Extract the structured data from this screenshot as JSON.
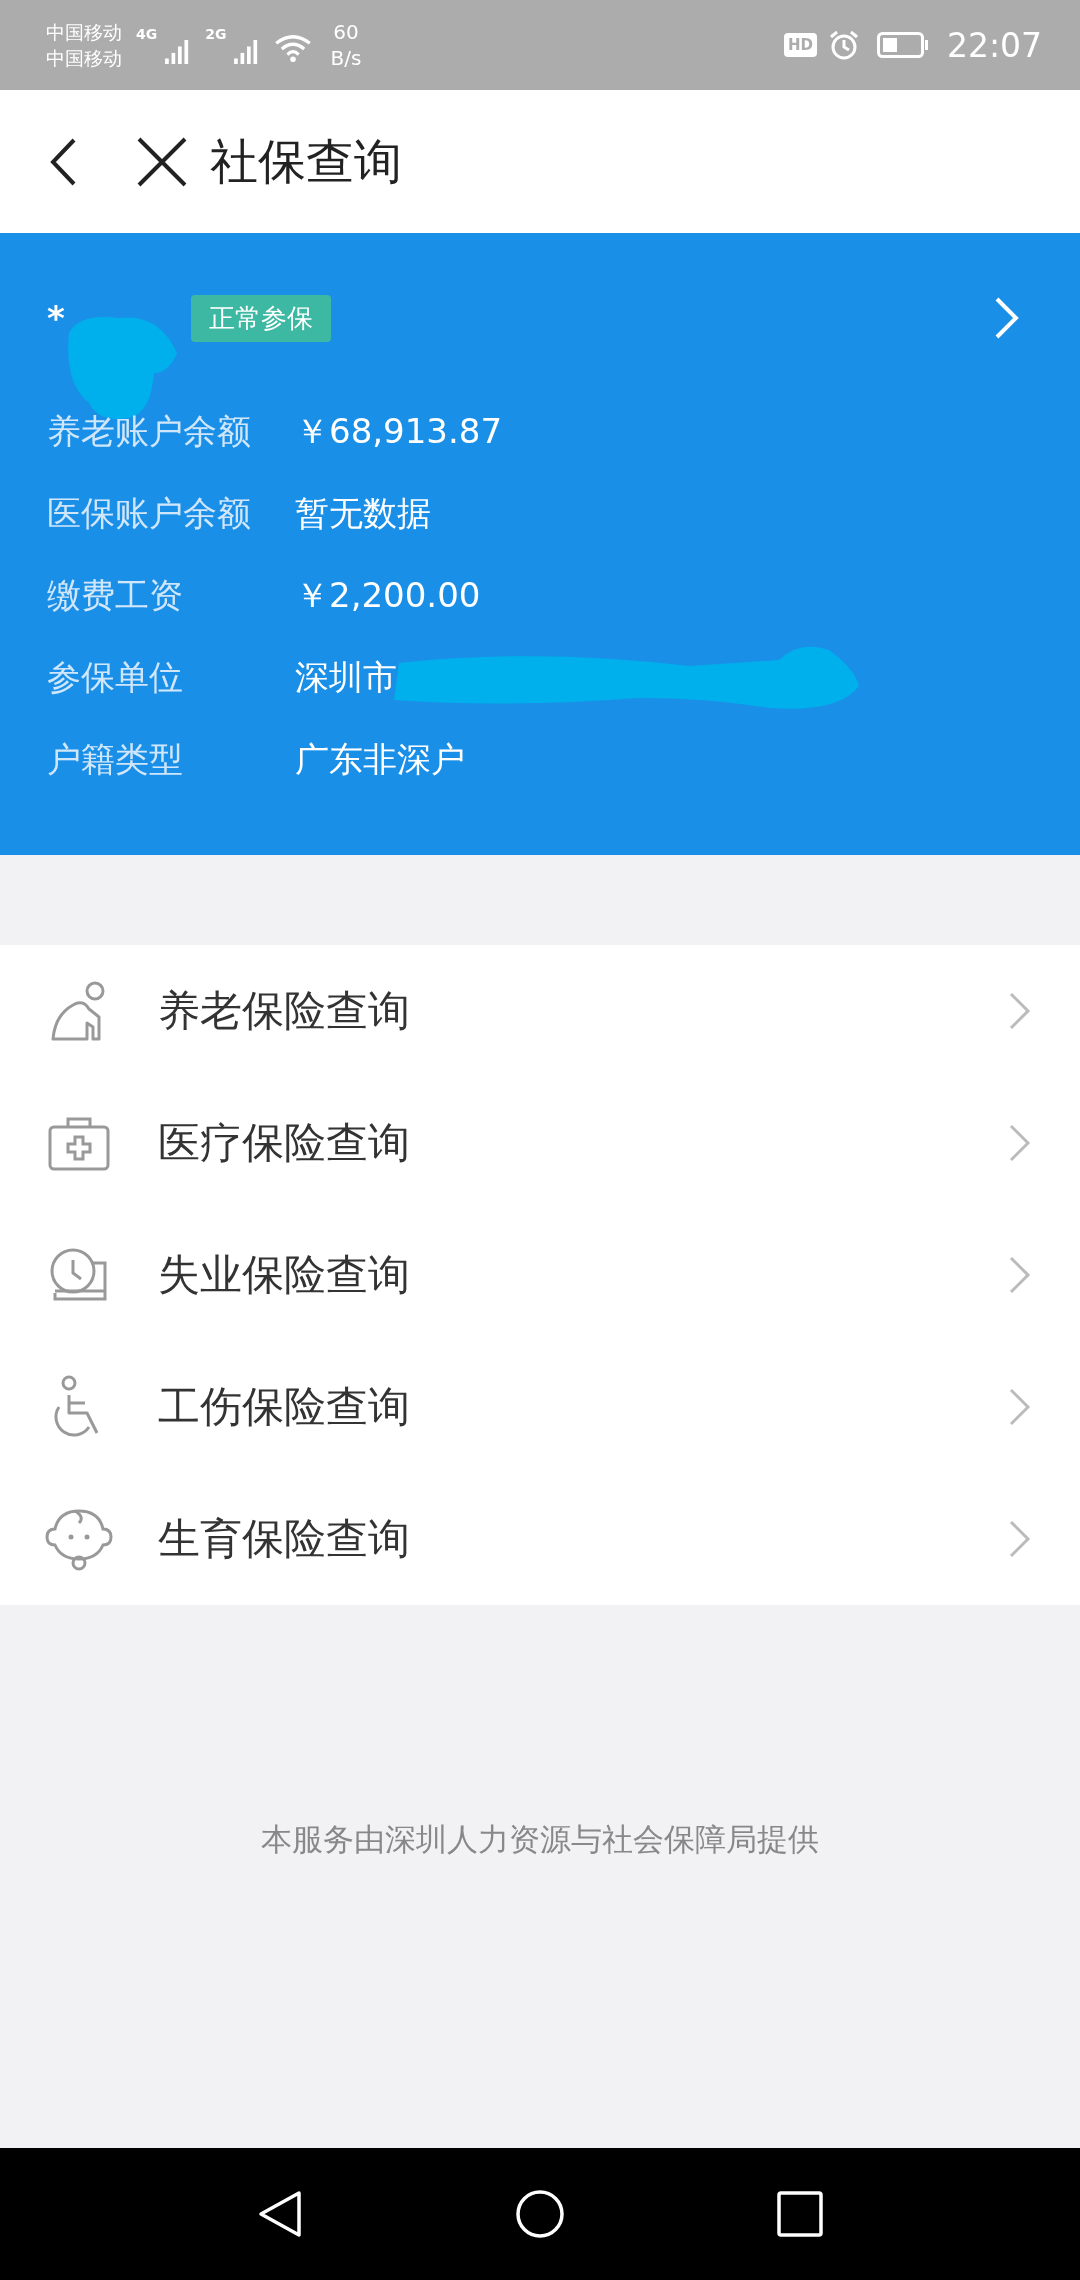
{
  "status_bar": {
    "carriers": [
      "中国移动",
      "中国移动"
    ],
    "network_types": [
      "4G",
      "2G"
    ],
    "speed_value": "60",
    "speed_unit": "B/s",
    "hd_label": "HD",
    "time": "22:07"
  },
  "header": {
    "title": "社保查询"
  },
  "account": {
    "name": "*",
    "status_badge": "正常参保",
    "fields": [
      {
        "label": "养老账户余额",
        "value": "￥68,913.87",
        "redacted": false
      },
      {
        "label": "医保账户余额",
        "value": "暂无数据",
        "redacted": false
      },
      {
        "label": "缴费工资",
        "value": "￥2,200.00",
        "redacted": false
      },
      {
        "label": "参保单位",
        "value": "深圳市",
        "redacted": true
      },
      {
        "label": "户籍类型",
        "value": "广东非深户",
        "redacted": false
      }
    ]
  },
  "menu": [
    {
      "kind": "pension",
      "label": "养老保险查询"
    },
    {
      "kind": "medical",
      "label": "医疗保险查询"
    },
    {
      "kind": "unemployment",
      "label": "失业保险查询"
    },
    {
      "kind": "injury",
      "label": "工伤保险查询"
    },
    {
      "kind": "maternity",
      "label": "生育保险查询"
    }
  ],
  "footer": "本服务由深圳人力资源与社会保障局提供"
}
